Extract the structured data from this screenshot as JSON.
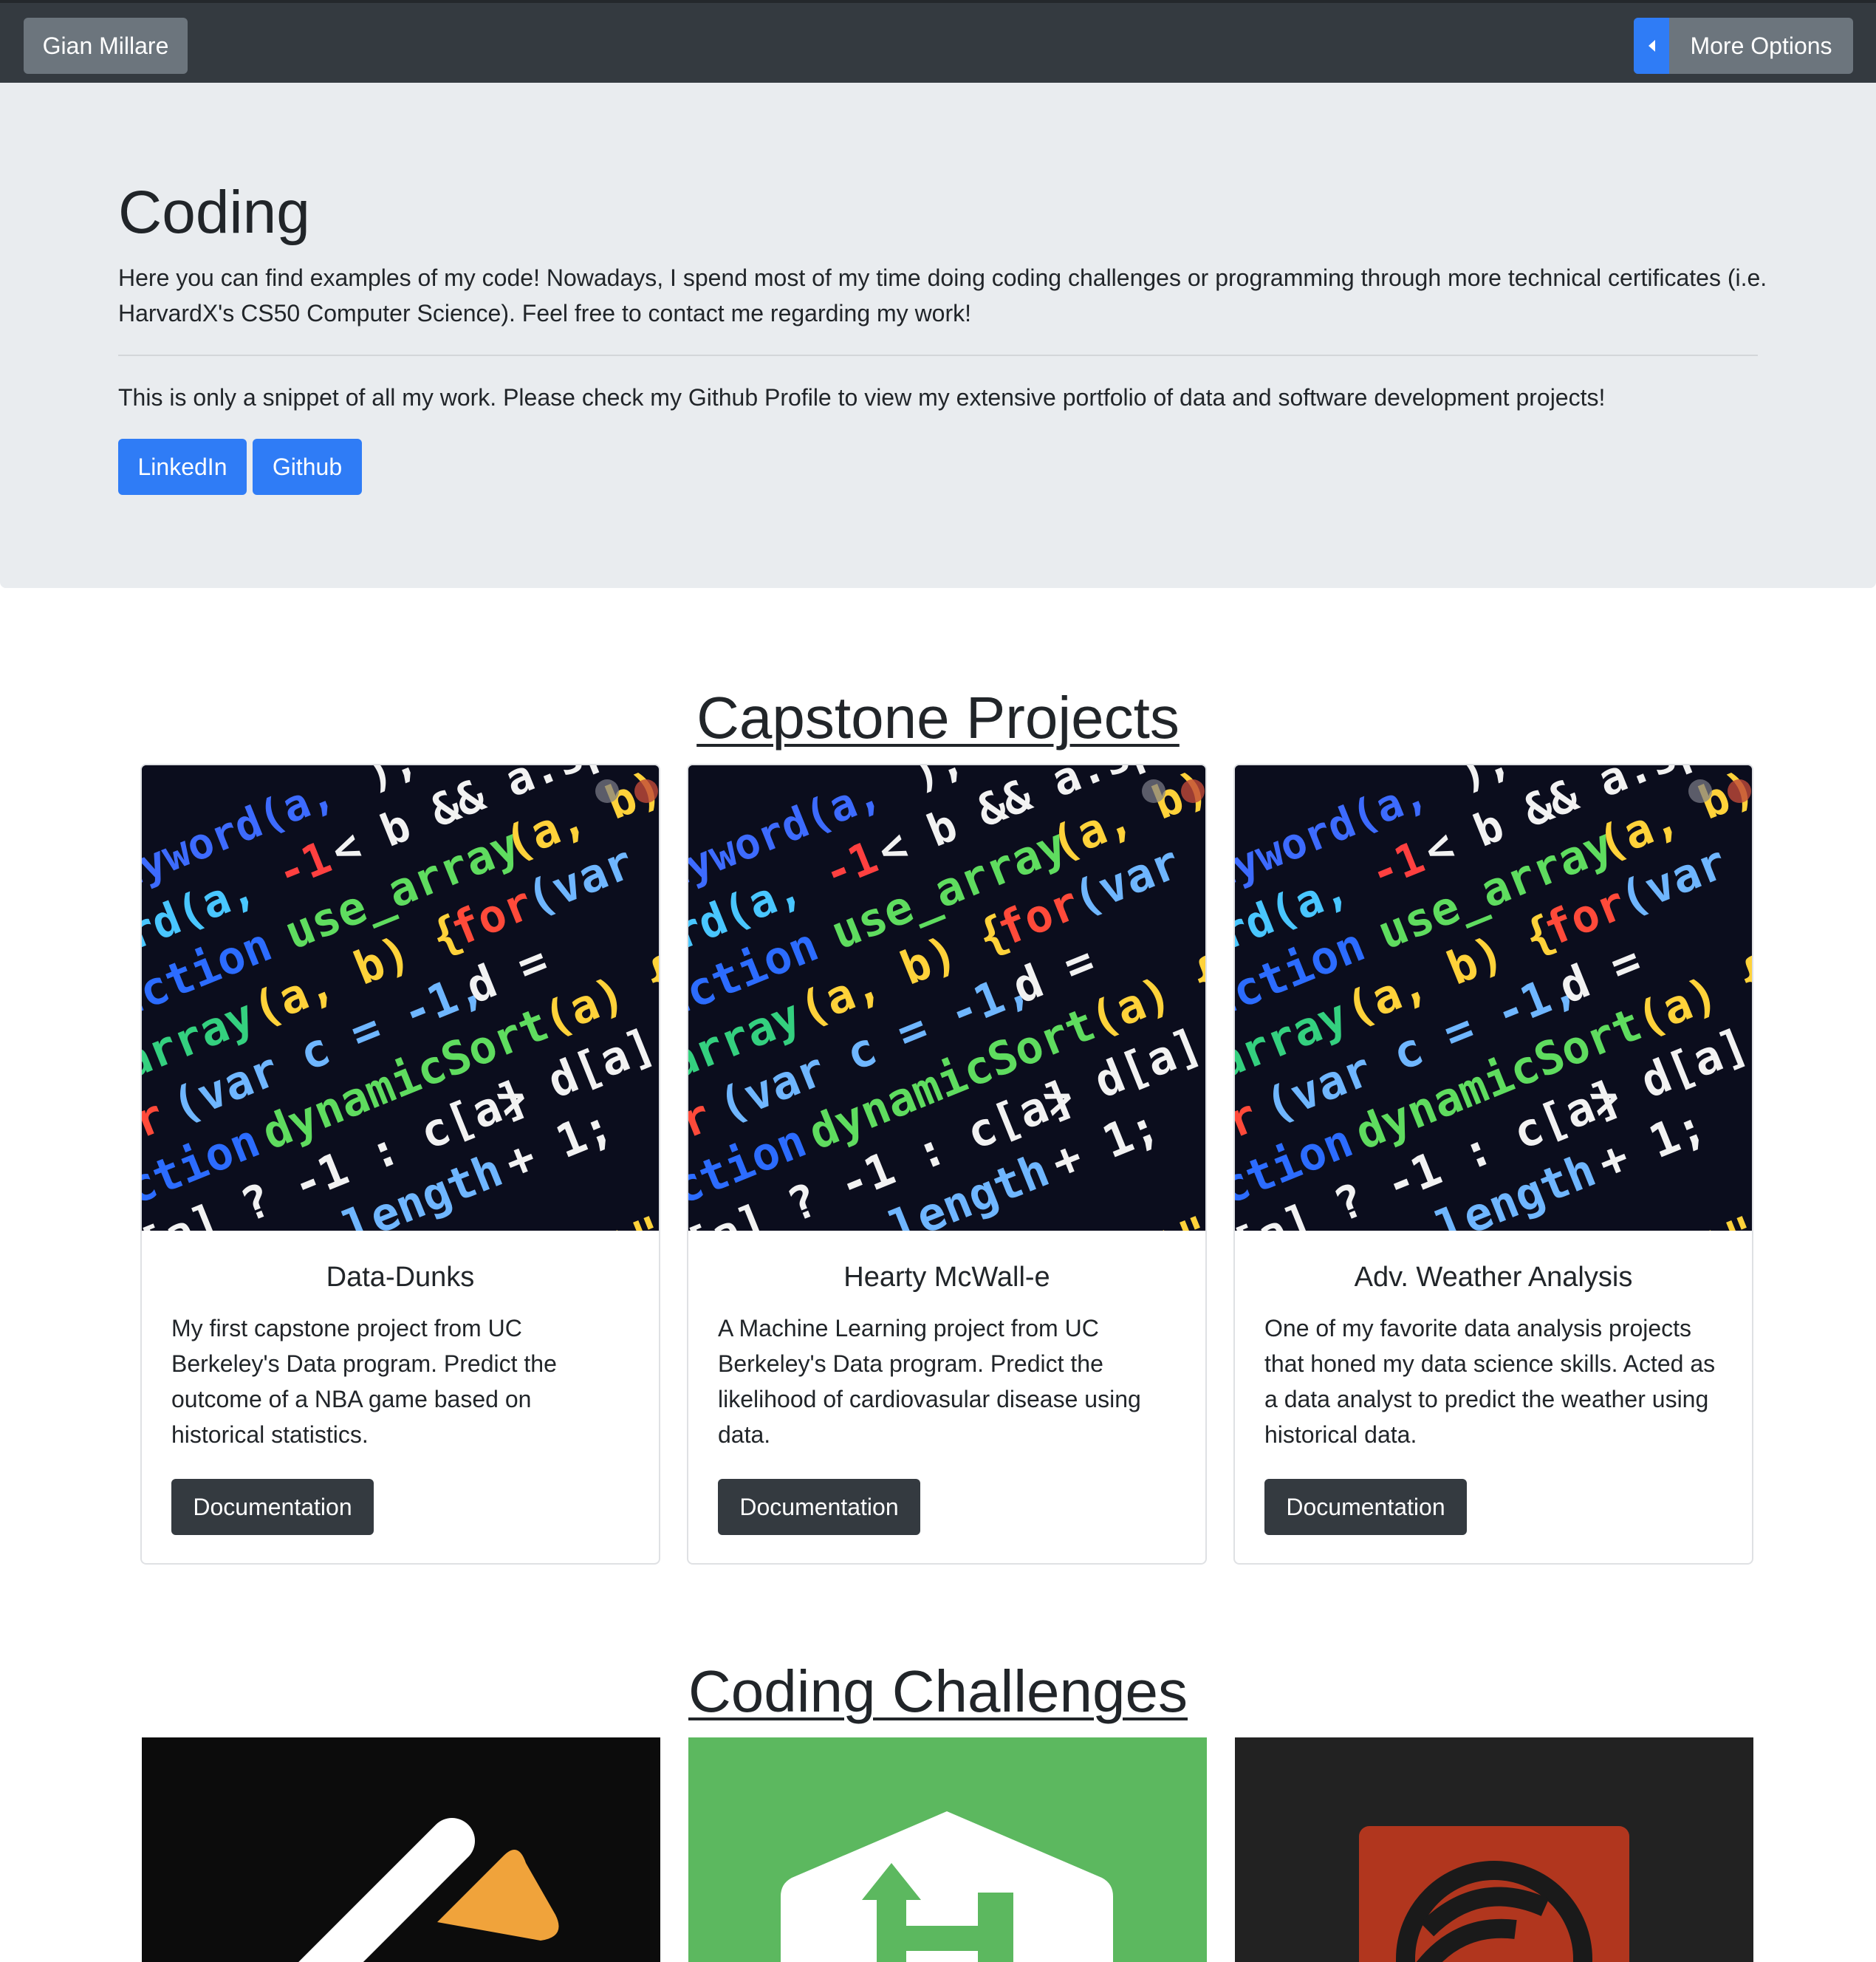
{
  "navbar": {
    "brand": "Gian Millare",
    "more_options": "More Options"
  },
  "hero": {
    "title": "Coding",
    "lead": "Here you can find examples of my code! Nowadays, I spend most of my time doing coding challenges or programming through more technical certificates (i.e. HarvardX's CS50 Computer Science). Feel free to contact me regarding my work!",
    "note": "This is only a snippet of all my work. Please check my Github Profile to view my extensive portfolio of data and software development projects!",
    "buttons": [
      "LinkedIn",
      "Github"
    ]
  },
  "capstone": {
    "heading": "Capstone Projects",
    "cards": [
      {
        "title": "Data-Dunks",
        "text": "My first capstone project from UC Berkeley's Data program. Predict the outcome of a NBA game based on historical statistics.",
        "button": "Documentation"
      },
      {
        "title": "Hearty McWall-e",
        "text": "A Machine Learning project from UC Berkeley's Data program. Predict the likelihood of cardiovasular disease using data.",
        "button": "Documentation"
      },
      {
        "title": "Adv. Weather Analysis",
        "text": "One of my favorite data analysis projects that honed my data science skills. Acted as a data analyst to predict the weather using historical data.",
        "button": "Documentation"
      }
    ]
  },
  "challenges": {
    "heading": "Coding Challenges"
  },
  "colors": {
    "navbar": "#343a40",
    "primary": "#2f7cf6",
    "secondary": "#6c757d",
    "jumbotron": "#e9ecef",
    "dark_button": "#343a40",
    "hackerrank_green": "#5cb85f"
  }
}
